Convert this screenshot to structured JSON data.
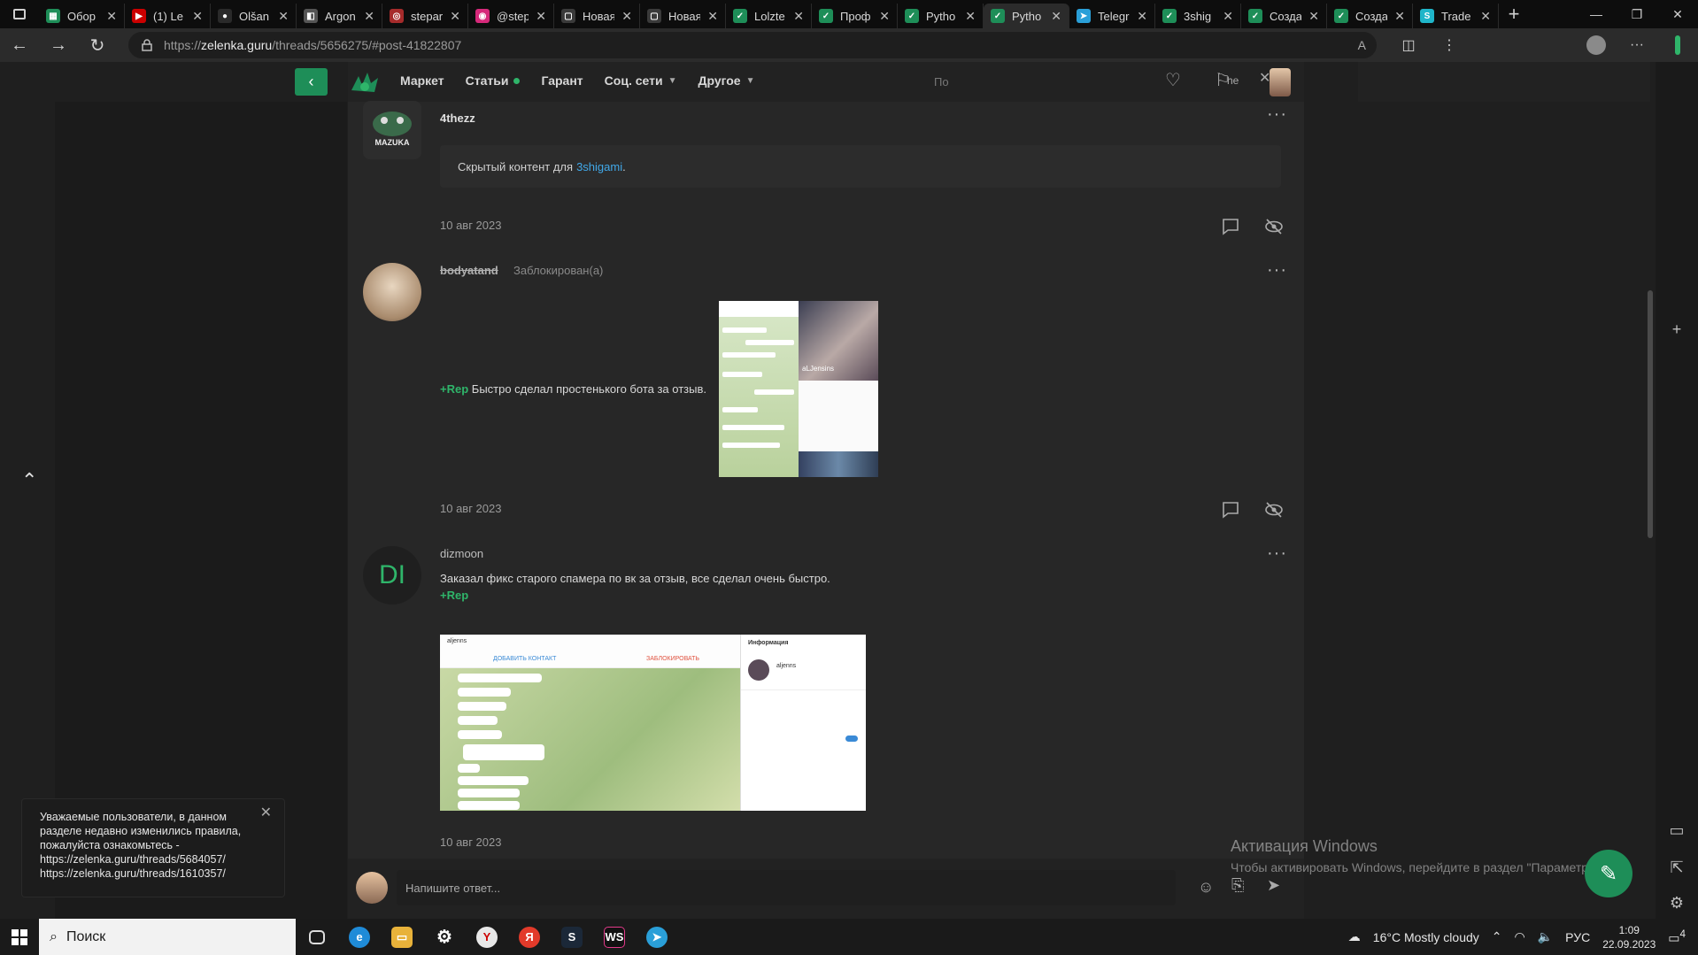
{
  "browser": {
    "tabs": [
      {
        "label": "Обор",
        "color": "#1e8e58",
        "glyph": "▦"
      },
      {
        "label": "(1) Le",
        "color": "#cc0000",
        "glyph": "▶"
      },
      {
        "label": "Olšan",
        "color": "#2a2a2a",
        "glyph": "●"
      },
      {
        "label": "Argon",
        "color": "#555555",
        "glyph": "◧"
      },
      {
        "label": "stepar",
        "color": "#a62b2b",
        "glyph": "◎"
      },
      {
        "label": "@step",
        "color": "#d6297a",
        "glyph": "◉"
      },
      {
        "label": "Новая",
        "color": "#3a3a3a",
        "glyph": "▢"
      },
      {
        "label": "Новая",
        "color": "#3a3a3a",
        "glyph": "▢"
      },
      {
        "label": "Lolzte",
        "color": "#1e8e58",
        "glyph": "✓"
      },
      {
        "label": "Проф",
        "color": "#1e8e58",
        "glyph": "✓"
      },
      {
        "label": "Pytho",
        "color": "#1e8e58",
        "glyph": "✓"
      },
      {
        "label": "Pytho",
        "color": "#1e8e58",
        "glyph": "✓"
      },
      {
        "label": "Telegr",
        "color": "#2a9fd8",
        "glyph": "➤"
      },
      {
        "label": "3shig",
        "color": "#1e8e58",
        "glyph": "✓"
      },
      {
        "label": "Созда",
        "color": "#1e8e58",
        "glyph": "✓"
      },
      {
        "label": "Созда",
        "color": "#1e8e58",
        "glyph": "✓"
      },
      {
        "label": "Trade",
        "color": "#1fb5c9",
        "glyph": "S"
      }
    ],
    "active_tab": 11,
    "url_prefix": "https://",
    "url_host": "zelenka.guru",
    "url_path": "/threads/5656275/#post-41822807"
  },
  "site": {
    "nav": [
      "Маркет",
      "Статьи",
      "Гарант",
      "Соц. сети",
      "Другое"
    ],
    "search_placeholder": "По",
    "header_badge": "he"
  },
  "posts": [
    {
      "user": "4thezz",
      "hidden_prefix": "Скрытый контент для",
      "hidden_link": "3shigami",
      "hidden_suffix": ".",
      "date": "10 авг 2023",
      "avatar_text": "MAZUKA"
    },
    {
      "user": "bodyatand",
      "status": "Заблокирован(а)",
      "rep": "+Rep",
      "text": "Быстро сделал простенького бота за отзыв.",
      "date": "10 авг 2023",
      "image_caption": "aLJensins"
    },
    {
      "user": "dizmoon",
      "avatar_initials": "DI",
      "text": "Заказал фикс старого спамера по вк за отзыв, все сделал очень быстро.",
      "rep": "+Rep",
      "date": "10 авг 2023",
      "image_header_left": "aljenns",
      "image_add_contact": "ДОБАВИТЬ КОНТАКТ",
      "image_block": "ЗАБЛОКИРОВАТЬ",
      "image_info_title": "Информация",
      "image_contact_name": "aljenns"
    }
  ],
  "toast": {
    "text": "Уважаемые пользователи, в данном разделе недавно изменились правила, пожалуйста ознакомьтесь -",
    "link1": "https://zelenka.guru/threads/5684057/",
    "link2": "https://zelenka.guru/threads/1610357/"
  },
  "reply": {
    "placeholder": "Напишите ответ..."
  },
  "watermark": {
    "title": "Активация Windows",
    "subtitle": "Чтобы активировать Windows, перейдите в раздел \"Параметры\""
  },
  "taskbar": {
    "search": "Поиск",
    "weather": "16°C  Mostly cloudy",
    "lang": "РУС",
    "time": "1:09",
    "date": "22.09.2023",
    "notif_count": "4"
  }
}
